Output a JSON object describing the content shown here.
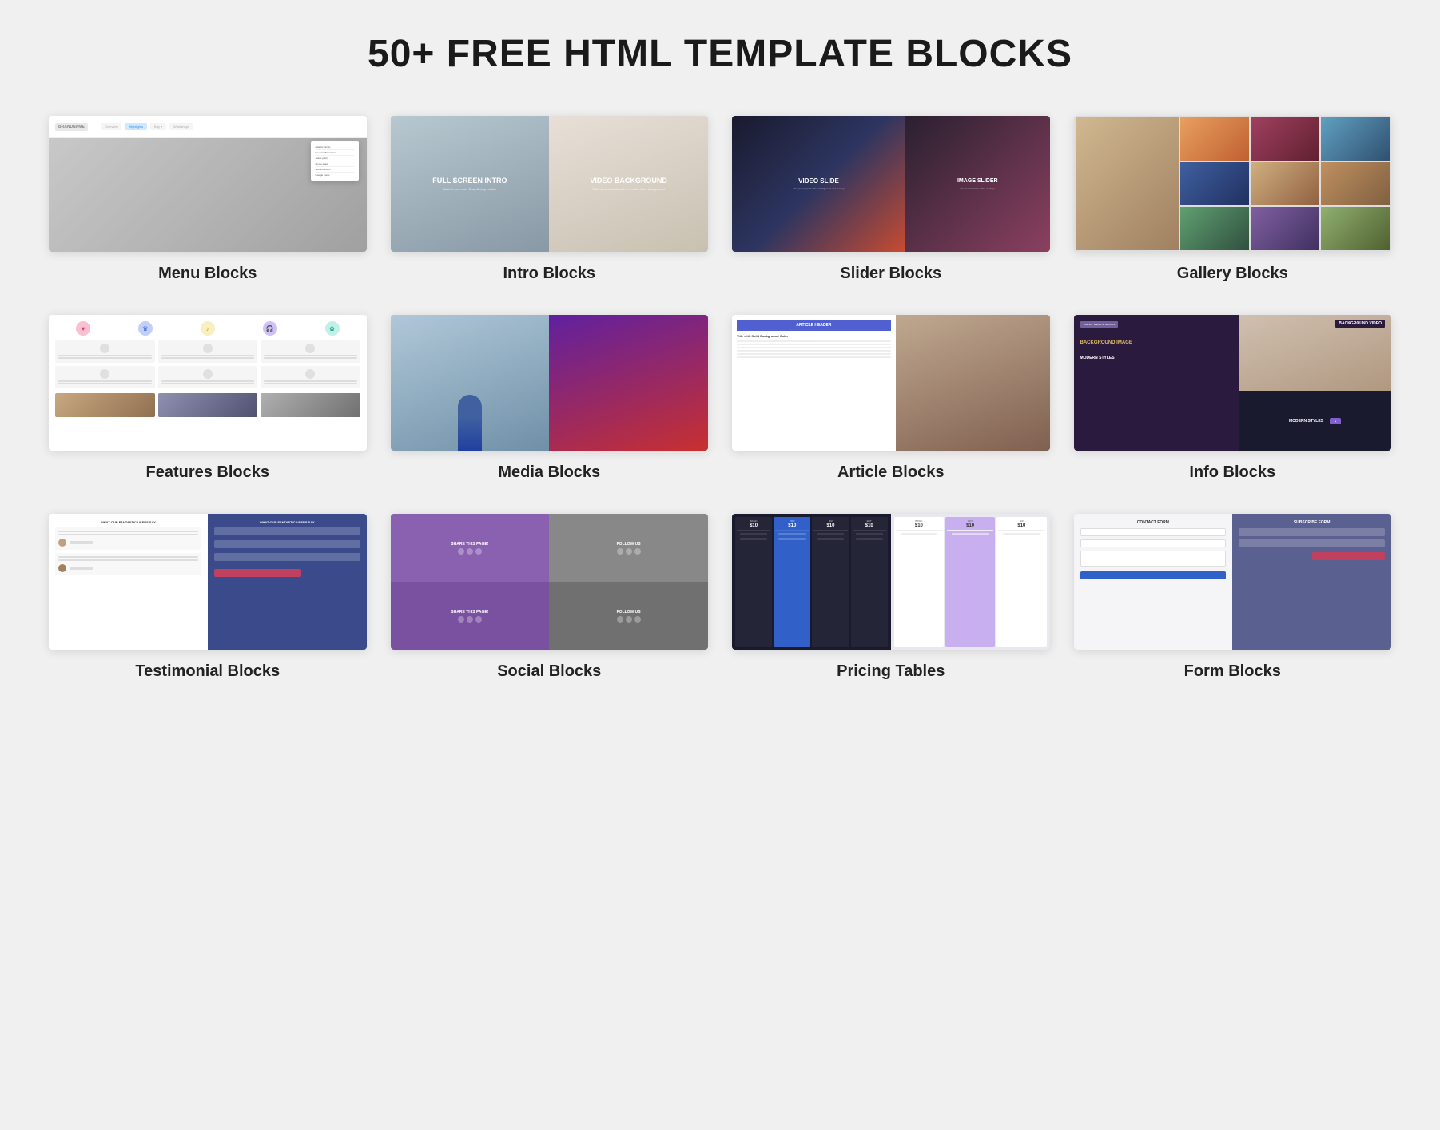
{
  "page": {
    "title": "50+ FREE HTML TEMPLATE BLOCKS"
  },
  "blocks": [
    {
      "id": "menu",
      "label": "Menu Blocks",
      "preview_type": "menu"
    },
    {
      "id": "intro",
      "label": "Intro Blocks",
      "preview_type": "intro"
    },
    {
      "id": "slider",
      "label": "Slider Blocks",
      "preview_type": "slider"
    },
    {
      "id": "gallery",
      "label": "Gallery Blocks",
      "preview_type": "gallery"
    },
    {
      "id": "features",
      "label": "Features Blocks",
      "preview_type": "features"
    },
    {
      "id": "media",
      "label": "Media Blocks",
      "preview_type": "media"
    },
    {
      "id": "article",
      "label": "Article Blocks",
      "preview_type": "article"
    },
    {
      "id": "info",
      "label": "Info Blocks",
      "preview_type": "info"
    },
    {
      "id": "testimonial",
      "label": "Testimonial Blocks",
      "preview_type": "testimonial"
    },
    {
      "id": "social",
      "label": "Social Blocks",
      "preview_type": "social"
    },
    {
      "id": "pricing",
      "label": "Pricing Tables",
      "preview_type": "pricing"
    },
    {
      "id": "form",
      "label": "Form Blocks",
      "preview_type": "form"
    }
  ],
  "previews": {
    "menu": {
      "brand": "BRANDNAME",
      "nav_items": [
        "Overview",
        "Highlights",
        "Buy",
        "Workshops"
      ],
      "dropdown_items": [
        "Atlanta Family",
        "Board in Barcelona",
        "Jeans policy",
        "Single stage",
        "Social Buttons",
        "Google Fonts"
      ]
    },
    "intro": {
      "left_title": "FULL SCREEN INTRO",
      "left_sub": "Make it your own Drag & drop builder",
      "right_title": "VIDEO BACKGROUND",
      "right_sub": "Build your website with a flexible video background and other overlay"
    },
    "slider": {
      "left_title": "VIDEO SLIDE",
      "left_sub": "Use your popular video background and other overlay",
      "right_title": "IMAGE SLIDER",
      "right_sub": "Create immersive slider overlays coming starting with the text"
    },
    "article": {
      "header_text": "ARTICLE HEADER",
      "subtitle": "Title with Solid Background Color"
    },
    "info": {
      "tag": "TRENDY WEBSITE BLOCKS",
      "title": "BACKGROUND VIDEO",
      "title2": "BACKGROUND IMAGE",
      "title3": "MODERN STYLES"
    },
    "social": {
      "share_text": "SHARE THIS PAGE!",
      "follow_text": "FOLLOW US"
    },
    "pricing": {
      "columns": [
        "$10/m",
        "$10/m",
        "$10/m",
        "$10/m"
      ],
      "featured_index": 1
    },
    "testimonial": {
      "title": "WHAT OUR FANTASTIC USERS SAY"
    }
  }
}
